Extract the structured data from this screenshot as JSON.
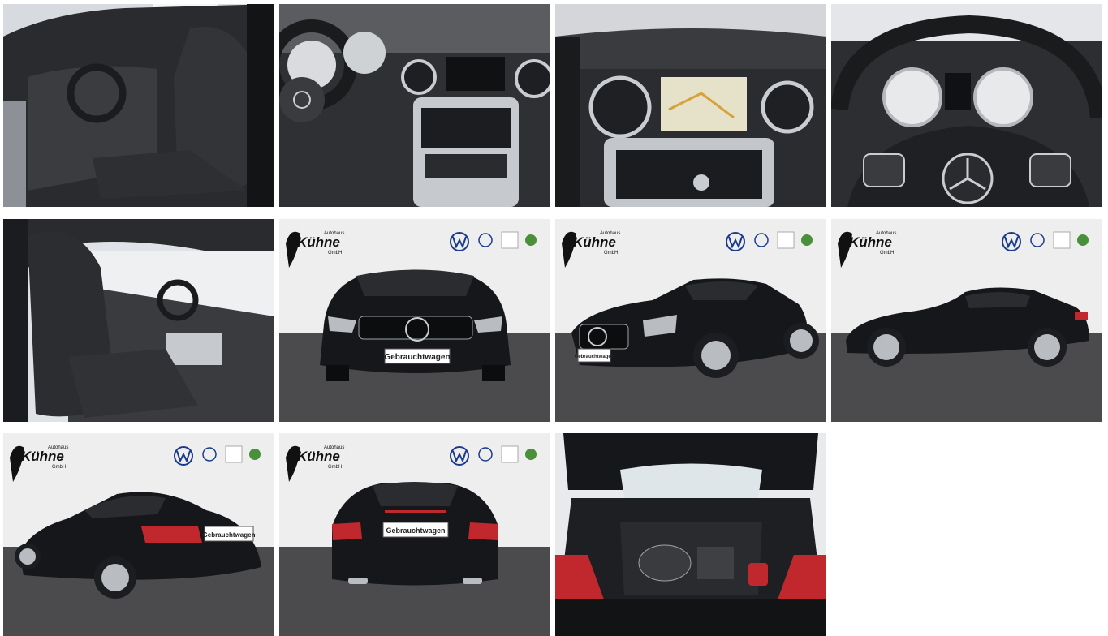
{
  "gallery": {
    "tiles": [
      {
        "label": "interior-driver-side"
      },
      {
        "label": "dashboard-steering-wheel"
      },
      {
        "label": "center-console-navigation"
      },
      {
        "label": "instrument-cluster"
      },
      {
        "label": "interior-passenger-side"
      },
      {
        "label": "exterior-front",
        "plate": "Gebrauchtwagen"
      },
      {
        "label": "exterior-front-three-quarter",
        "plate": "Gebrauchtwagen"
      },
      {
        "label": "exterior-side"
      },
      {
        "label": "exterior-rear-three-quarter",
        "plate": "Gebrauchtwagen"
      },
      {
        "label": "exterior-rear",
        "plate": "Gebrauchtwagen"
      },
      {
        "label": "trunk-open"
      }
    ]
  },
  "dealer": {
    "logo_small": "Autohaus",
    "logo_name": "Kühne",
    "logo_suffix": "GmbH"
  },
  "colors": {
    "car_black": "#16171a",
    "studio_wall": "#eeeeee",
    "studio_floor": "#4b4b4d",
    "leather": "#2b2c2f",
    "chrome": "#c9ccd0",
    "taillight": "#c0282e",
    "vw_blue": "#1a3a8c"
  }
}
